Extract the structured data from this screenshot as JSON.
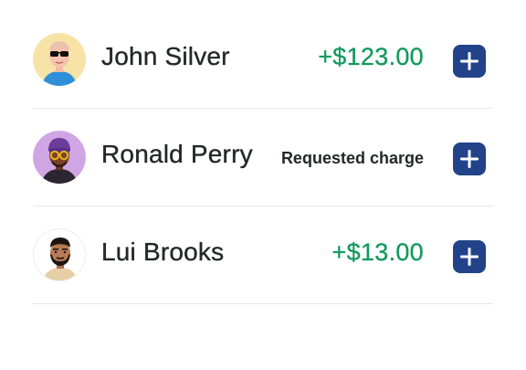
{
  "transactions": [
    {
      "name": "John Silver",
      "amount": "+$123.00",
      "avatar_icon": "avatar-sunglasses-man-icon",
      "add_icon": "plus-icon"
    },
    {
      "name": "Ronald Perry",
      "status": "Requested charge",
      "avatar_icon": "avatar-beanie-man-icon",
      "add_icon": "plus-icon"
    },
    {
      "name": "Lui Brooks",
      "amount": "+$13.00",
      "avatar_icon": "avatar-bearded-man-icon",
      "add_icon": "plus-icon"
    }
  ],
  "colors": {
    "positive_amount": "#139a5c",
    "button": "#22438a",
    "divider": "#e6e7ea"
  }
}
